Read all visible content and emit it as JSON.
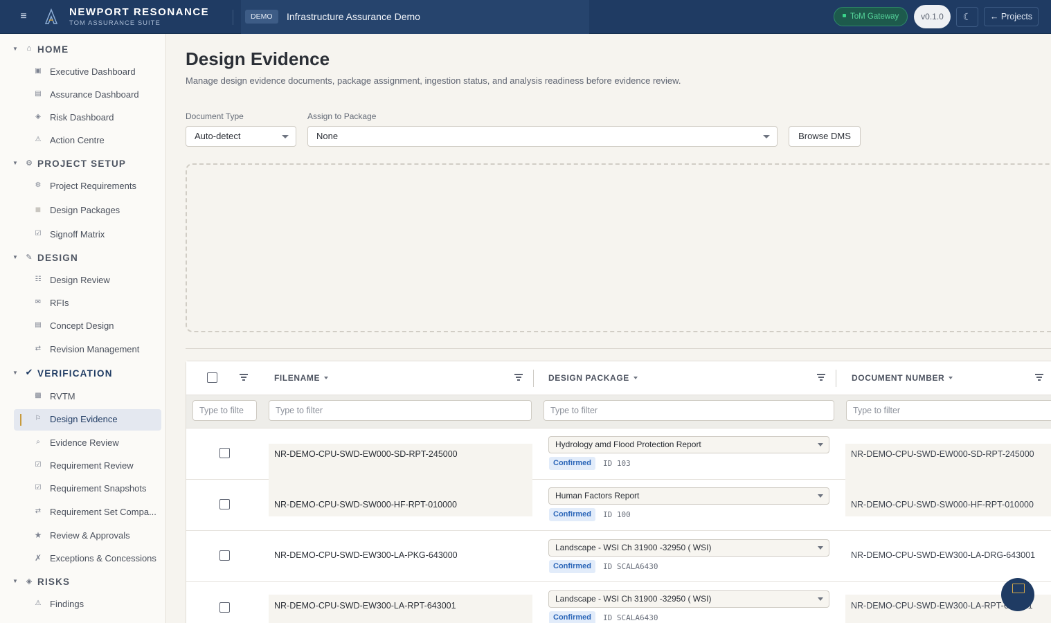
{
  "header": {
    "brand_title": "NEWPORT RESONANCE",
    "brand_subtitle": "TOM ASSURANCE SUITE",
    "demo_badge": "DEMO",
    "project_name": "Infrastructure Assurance Demo",
    "gateway_label": "ToM Gateway",
    "version": "v0.1.0",
    "projects_button": "← Projects"
  },
  "sidebar": {
    "sections": [
      {
        "label": "HOME",
        "icon": "home-icon",
        "items": [
          {
            "label": "Executive Dashboard",
            "icon": "dashboard-icon"
          },
          {
            "label": "Assurance Dashboard",
            "icon": "dashboard-icon"
          },
          {
            "label": "Risk Dashboard",
            "icon": "diamond-icon"
          },
          {
            "label": "Action Centre",
            "icon": "warning-icon"
          }
        ]
      },
      {
        "label": "PROJECT SETUP",
        "icon": "gear-icon",
        "items": [
          {
            "label": "Project Requirements",
            "icon": "gear-icon"
          },
          {
            "label": "Design Packages",
            "icon": "package-icon"
          },
          {
            "label": "Signoff Matrix",
            "icon": "checkbox-icon"
          }
        ]
      },
      {
        "label": "DESIGN",
        "icon": "pencil-icon",
        "items": [
          {
            "label": "Design Review",
            "icon": "list-icon"
          },
          {
            "label": "RFIs",
            "icon": "mail-icon"
          },
          {
            "label": "Concept Design",
            "icon": "document-icon"
          },
          {
            "label": "Revision Management",
            "icon": "swap-icon"
          }
        ]
      },
      {
        "label": "VERIFICATION",
        "icon": "check-icon",
        "items": [
          {
            "label": "RVTM",
            "icon": "grid-icon"
          },
          {
            "label": "Design Evidence",
            "icon": "flag-icon",
            "active": true
          },
          {
            "label": "Evidence Review",
            "icon": "magnifier-icon"
          },
          {
            "label": "Requirement Review",
            "icon": "checkbox-icon"
          },
          {
            "label": "Requirement Snapshots",
            "icon": "checkbox-icon"
          },
          {
            "label": "Requirement Set Compa...",
            "icon": "swap-icon"
          },
          {
            "label": "Review & Approvals",
            "icon": "star-icon"
          },
          {
            "label": "Exceptions & Concessions",
            "icon": "cross-icon"
          }
        ]
      },
      {
        "label": "RISKS",
        "icon": "diamond-icon",
        "items": [
          {
            "label": "Findings",
            "icon": "warning-icon"
          }
        ]
      }
    ]
  },
  "main": {
    "title": "Design Evidence",
    "description": "Manage design evidence documents, package assignment, ingestion status, and analysis readiness before evidence review.",
    "document_type": {
      "label": "Document Type",
      "value": "Auto-detect"
    },
    "assign_package": {
      "label": "Assign to Package",
      "value": "None"
    },
    "browse_button": "Browse DMS"
  },
  "grid": {
    "columns": [
      "FILENAME",
      "DESIGN PACKAGE",
      "DOCUMENT NUMBER"
    ],
    "filter_placeholder_short": "Type to filte",
    "filter_placeholder": "Type to filter",
    "rows": [
      {
        "filename": "NR-DEMO-CPU-SWD-EW000-SD-RPT-245000",
        "package": "Hydrology amd Flood Protection Report",
        "status": "Confirmed",
        "package_id": "ID 103",
        "document_number": "NR-DEMO-CPU-SWD-EW000-SD-RPT-245000"
      },
      {
        "filename": "NR-DEMO-CPU-SWD-SW000-HF-RPT-010000",
        "package": "Human Factors Report",
        "status": "Confirmed",
        "package_id": "ID 100",
        "document_number": "NR-DEMO-CPU-SWD-SW000-HF-RPT-010000"
      },
      {
        "filename": "NR-DEMO-CPU-SWD-EW300-LA-PKG-643000",
        "package": "Landscape - WSI Ch 31900 -32950 ( WSI)",
        "status": "Confirmed",
        "package_id": "ID SCALA6430",
        "document_number": "NR-DEMO-CPU-SWD-EW300-LA-DRG-643001"
      },
      {
        "filename": "NR-DEMO-CPU-SWD-EW300-LA-RPT-643001",
        "package": "Landscape - WSI Ch 31900 -32950 ( WSI)",
        "status": "Confirmed",
        "package_id": "ID SCALA6430",
        "document_number": "NR-DEMO-CPU-SWD-EW300-LA-RPT-643001"
      }
    ]
  },
  "colors": {
    "topbar": "#1f3b63",
    "accent_gold": "#c79a3d",
    "confirmed_badge": "#2b66b8"
  }
}
